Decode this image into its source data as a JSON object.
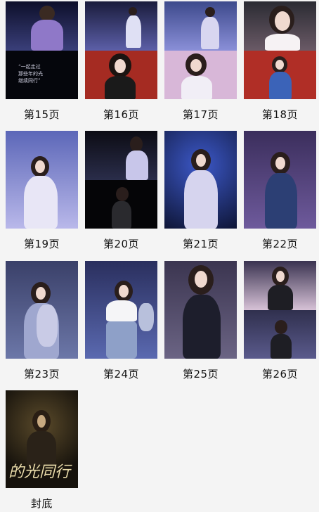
{
  "pages": [
    {
      "label": "第15页"
    },
    {
      "label": "第16页"
    },
    {
      "label": "第17页"
    },
    {
      "label": "第18页"
    },
    {
      "label": "第19页"
    },
    {
      "label": "第20页"
    },
    {
      "label": "第21页"
    },
    {
      "label": "第22页"
    },
    {
      "label": "第23页"
    },
    {
      "label": "第24页"
    },
    {
      "label": "第25页"
    },
    {
      "label": "第26页"
    },
    {
      "label": "封底"
    }
  ],
  "back_cover": {
    "title": "的光同行"
  }
}
